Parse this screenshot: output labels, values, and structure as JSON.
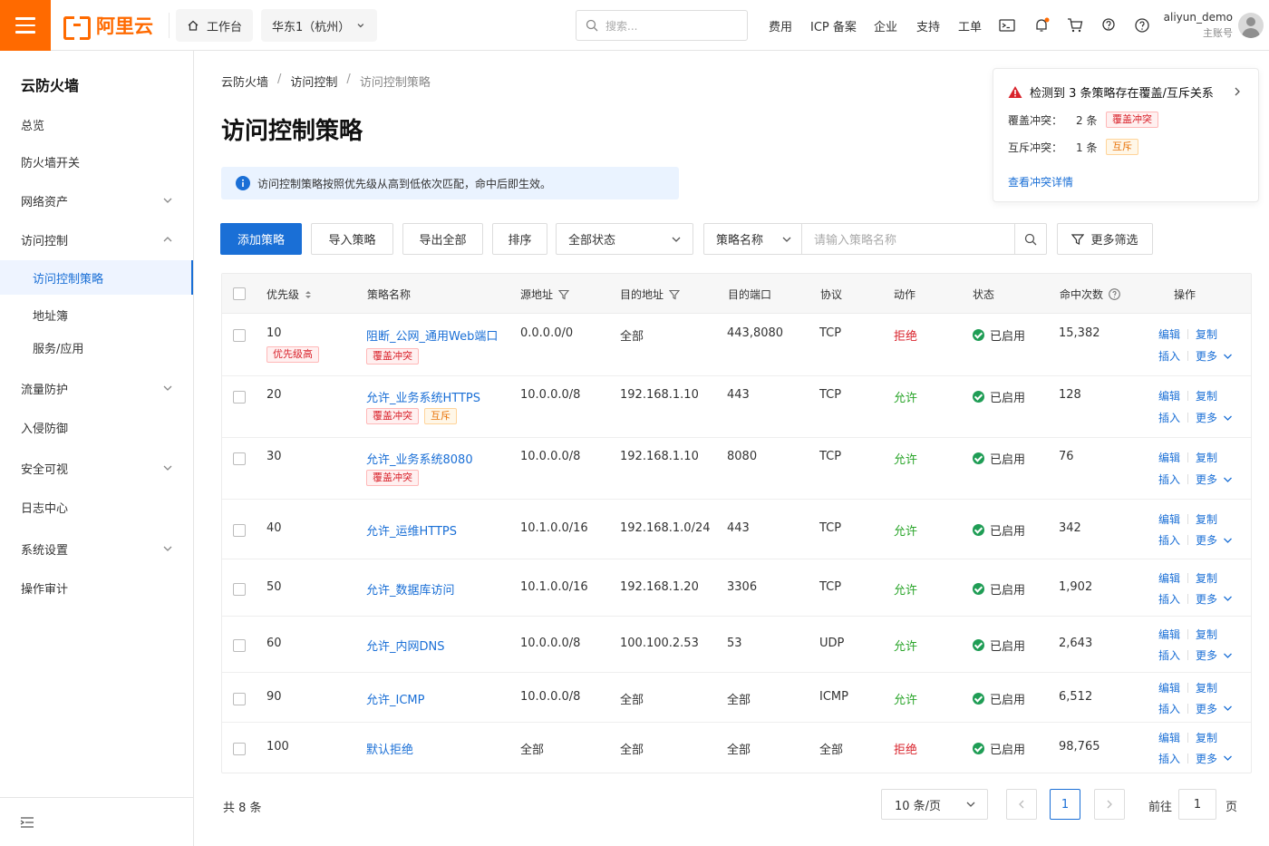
{
  "header": {
    "logo_text": "阿里云",
    "workbench": "工作台",
    "region": "华东1（杭州）",
    "search_placeholder": "搜索...",
    "nav": [
      "费用",
      "ICP 备案",
      "企业",
      "支持",
      "工单"
    ],
    "user_name": "aliyun_demo",
    "user_role": "主账号"
  },
  "sidebar": {
    "title": "云防火墙",
    "items": [
      "总览",
      "防火墙开关",
      "网络资产",
      "访问控制",
      "访问控制策略",
      "地址簿",
      "服务/应用",
      "流量防护",
      "入侵防御",
      "安全可视",
      "日志中心",
      "系统设置",
      "操作审计"
    ]
  },
  "breadcrumb": [
    "云防火墙",
    "访问控制",
    "访问控制策略"
  ],
  "page_title": "访问控制策略",
  "info_text": "访问控制策略按照优先级从高到低依次匹配，命中后即生效。",
  "conflict": {
    "title": "检测到 3 条策略存在覆盖/互斥关系",
    "cover_label": "覆盖冲突：",
    "cover_count": "2 条",
    "cover_tag": "覆盖冲突",
    "mutex_label": "互斥冲突：",
    "mutex_count": "1 条",
    "mutex_tag": "互斥",
    "link": "查看冲突详情"
  },
  "toolbar": {
    "add": "添加策略",
    "import": "导入策略",
    "export": "导出全部",
    "sort": "排序",
    "status_select": "全部状态",
    "field_select": "策略名称",
    "name_placeholder": "请输入策略名称",
    "more_filter": "更多筛选"
  },
  "table": {
    "headers": [
      "优先级",
      "策略名称",
      "源地址",
      "目的地址",
      "目的端口",
      "协议",
      "动作",
      "状态",
      "命中次数",
      "操作"
    ],
    "rows": [
      {
        "priority": "10",
        "name": "阻断_公网_通用Web端口",
        "src": "0.0.0.0/0",
        "dst": "全部",
        "port": "443,8080",
        "proto": "TCP",
        "action": "拒绝",
        "status": "已启用",
        "hits": "15,382",
        "tags": [
          "优先级高",
          "覆盖冲突"
        ]
      },
      {
        "priority": "20",
        "name": "允许_业务系统HTTPS",
        "src": "10.0.0.0/8",
        "dst": "192.168.1.10",
        "port": "443",
        "proto": "TCP",
        "action": "允许",
        "status": "已启用",
        "hits": "128",
        "tags": [
          "覆盖冲突",
          "互斥"
        ]
      },
      {
        "priority": "30",
        "name": "允许_业务系统8080",
        "src": "10.0.0.0/8",
        "dst": "192.168.1.10",
        "port": "8080",
        "proto": "TCP",
        "action": "允许",
        "status": "已启用",
        "hits": "76",
        "tags": [
          "覆盖冲突"
        ]
      },
      {
        "priority": "40",
        "name": "允许_运维HTTPS",
        "src": "10.1.0.0/16",
        "dst": "192.168.1.0/24",
        "port": "443",
        "proto": "TCP",
        "action": "允许",
        "status": "已启用",
        "hits": "342",
        "tags": []
      },
      {
        "priority": "50",
        "name": "允许_数据库访问",
        "src": "10.1.0.0/16",
        "dst": "192.168.1.20",
        "port": "3306",
        "proto": "TCP",
        "action": "允许",
        "status": "已启用",
        "hits": "1,902",
        "tags": []
      },
      {
        "priority": "60",
        "name": "允许_内网DNS",
        "src": "10.0.0.0/8",
        "dst": "100.100.2.53",
        "port": "53",
        "proto": "UDP",
        "action": "允许",
        "status": "已启用",
        "hits": "2,643",
        "tags": []
      },
      {
        "priority": "90",
        "name": "允许_ICMP",
        "src": "10.0.0.0/8",
        "dst": "全部",
        "port": "全部",
        "proto": "ICMP",
        "action": "允许",
        "status": "已启用",
        "hits": "6,512",
        "tags": []
      },
      {
        "priority": "100",
        "name": "默认拒绝",
        "src": "全部",
        "dst": "全部",
        "port": "全部",
        "proto": "全部",
        "action": "拒绝",
        "status": "已启用",
        "hits": "98,765",
        "tags": []
      }
    ],
    "ops": {
      "edit": "编辑",
      "copy": "复制",
      "insert": "插入",
      "more": "更多"
    }
  },
  "pager": {
    "total": "共 8 条",
    "page_size": "10 条/页",
    "current": "1",
    "goto_label": "前往",
    "goto_value": "1",
    "page_suffix": "页"
  },
  "colors": {
    "accent": "#1a6fd6",
    "brand": "#ff6a00",
    "deny": "#d9232c",
    "allow": "#2aa52a"
  }
}
